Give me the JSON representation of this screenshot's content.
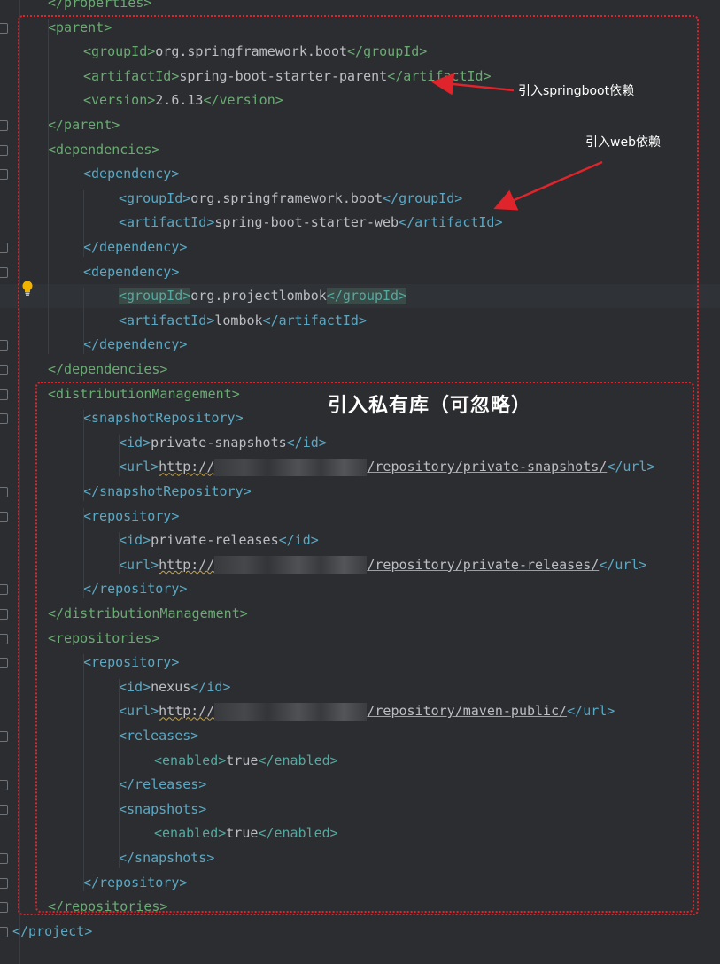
{
  "code_lines": [
    {
      "indent": 1,
      "segments": [
        [
          "tag",
          "</properties>"
        ]
      ]
    },
    {
      "indent": 1,
      "segments": [
        [
          "tag",
          "<parent>"
        ]
      ]
    },
    {
      "indent": 2,
      "segments": [
        [
          "tag",
          "<groupId>"
        ],
        [
          "txt",
          "org.springframework.boot"
        ],
        [
          "tag",
          "</groupId>"
        ]
      ]
    },
    {
      "indent": 2,
      "segments": [
        [
          "tag",
          "<artifactId>"
        ],
        [
          "txt",
          "spring-boot-starter-parent"
        ],
        [
          "tag",
          "</artifactId>"
        ]
      ]
    },
    {
      "indent": 2,
      "segments": [
        [
          "tag",
          "<version>"
        ],
        [
          "txt",
          "2.6.13"
        ],
        [
          "tag",
          "</version>"
        ]
      ]
    },
    {
      "indent": 1,
      "segments": [
        [
          "tag",
          "</parent>"
        ]
      ]
    },
    {
      "indent": 1,
      "segments": [
        [
          "tag",
          "<dependencies>"
        ]
      ]
    },
    {
      "indent": 2,
      "segments": [
        [
          "tag",
          "<dependency>"
        ]
      ]
    },
    {
      "indent": 3,
      "segments": [
        [
          "tag",
          "<groupId>"
        ],
        [
          "txt",
          "org.springframework.boot"
        ],
        [
          "tag",
          "</groupId>"
        ]
      ]
    },
    {
      "indent": 3,
      "segments": [
        [
          "tag",
          "<artifactId>"
        ],
        [
          "txt",
          "spring-boot-starter-web"
        ],
        [
          "tag",
          "</artifactId>"
        ]
      ]
    },
    {
      "indent": 2,
      "segments": [
        [
          "tag",
          "</dependency>"
        ]
      ]
    },
    {
      "indent": 2,
      "segments": [
        [
          "tag",
          "<dependency>"
        ]
      ]
    },
    {
      "indent": 3,
      "highlight": true,
      "segments": [
        [
          "match",
          "<groupId>"
        ],
        [
          "txt",
          "org.projectlombok"
        ],
        [
          "match",
          "</groupId>"
        ]
      ]
    },
    {
      "indent": 3,
      "segments": [
        [
          "tag",
          "<artifactId>"
        ],
        [
          "txt",
          "lombok"
        ],
        [
          "tag",
          "</artifactId>"
        ]
      ]
    },
    {
      "indent": 2,
      "segments": [
        [
          "tag",
          "</dependency>"
        ]
      ]
    },
    {
      "indent": 1,
      "segments": [
        [
          "tag",
          "</dependencies>"
        ]
      ]
    },
    {
      "indent": 1,
      "segments": [
        [
          "tag",
          "<distributionManagement>"
        ]
      ]
    },
    {
      "indent": 2,
      "segments": [
        [
          "tag",
          "<snapshotRepository>"
        ]
      ]
    },
    {
      "indent": 3,
      "segments": [
        [
          "tag",
          "<id>"
        ],
        [
          "txt",
          "private-snapshots"
        ],
        [
          "tag",
          "</id>"
        ]
      ]
    },
    {
      "indent": 3,
      "segments": [
        [
          "tag",
          "<url>"
        ],
        [
          "url",
          "http://"
        ],
        [
          "blur",
          ""
        ],
        [
          "url",
          "/repository/private-snapshots/"
        ],
        [
          "tag",
          "</url>"
        ]
      ]
    },
    {
      "indent": 2,
      "segments": [
        [
          "tag",
          "</snapshotRepository>"
        ]
      ]
    },
    {
      "indent": 2,
      "segments": [
        [
          "tag",
          "<repository>"
        ]
      ]
    },
    {
      "indent": 3,
      "segments": [
        [
          "tag",
          "<id>"
        ],
        [
          "txt",
          "private-releases"
        ],
        [
          "tag",
          "</id>"
        ]
      ]
    },
    {
      "indent": 3,
      "segments": [
        [
          "tag",
          "<url>"
        ],
        [
          "url",
          "http://"
        ],
        [
          "blur",
          ""
        ],
        [
          "url",
          "/repository/private-releases/"
        ],
        [
          "tag",
          "</url>"
        ]
      ]
    },
    {
      "indent": 2,
      "segments": [
        [
          "tag",
          "</repository>"
        ]
      ]
    },
    {
      "indent": 1,
      "segments": [
        [
          "tag",
          "</distributionManagement>"
        ]
      ]
    },
    {
      "indent": 1,
      "segments": [
        [
          "tag",
          "<repositories>"
        ]
      ]
    },
    {
      "indent": 2,
      "segments": [
        [
          "tag",
          "<repository>"
        ]
      ]
    },
    {
      "indent": 3,
      "segments": [
        [
          "tag",
          "<id>"
        ],
        [
          "txt",
          "nexus"
        ],
        [
          "tag",
          "</id>"
        ]
      ]
    },
    {
      "indent": 3,
      "segments": [
        [
          "tag",
          "<url>"
        ],
        [
          "url",
          "http://"
        ],
        [
          "blur",
          ""
        ],
        [
          "url",
          "/repository/maven-public/"
        ],
        [
          "tag",
          "</url>"
        ]
      ]
    },
    {
      "indent": 3,
      "segments": [
        [
          "tag",
          "<releases>"
        ]
      ]
    },
    {
      "indent": 4,
      "segments": [
        [
          "teal",
          "<enabled>"
        ],
        [
          "txt",
          "true"
        ],
        [
          "teal",
          "</enabled>"
        ]
      ]
    },
    {
      "indent": 3,
      "segments": [
        [
          "tag",
          "</releases>"
        ]
      ]
    },
    {
      "indent": 3,
      "segments": [
        [
          "tag",
          "<snapshots>"
        ]
      ]
    },
    {
      "indent": 4,
      "segments": [
        [
          "teal",
          "<enabled>"
        ],
        [
          "txt",
          "true"
        ],
        [
          "teal",
          "</enabled>"
        ]
      ]
    },
    {
      "indent": 3,
      "segments": [
        [
          "tag",
          "</snapshots>"
        ]
      ]
    },
    {
      "indent": 2,
      "segments": [
        [
          "tag",
          "</repository>"
        ]
      ]
    },
    {
      "indent": 1,
      "segments": [
        [
          "tag",
          "</repositories>"
        ]
      ]
    },
    {
      "indent": 0,
      "segments": [
        [
          "tag",
          "</project>"
        ]
      ]
    }
  ],
  "annotations": {
    "springboot_note": "引入springboot依赖",
    "web_note": "引入web依赖",
    "private_repo_note": "引入私有库（可忽略）"
  },
  "colors": {
    "background": "#2b2d30",
    "tag": "#5ba8c4",
    "tag_green": "#6aab73",
    "text": "#bcbec4",
    "annotation_red": "#e0242b"
  }
}
